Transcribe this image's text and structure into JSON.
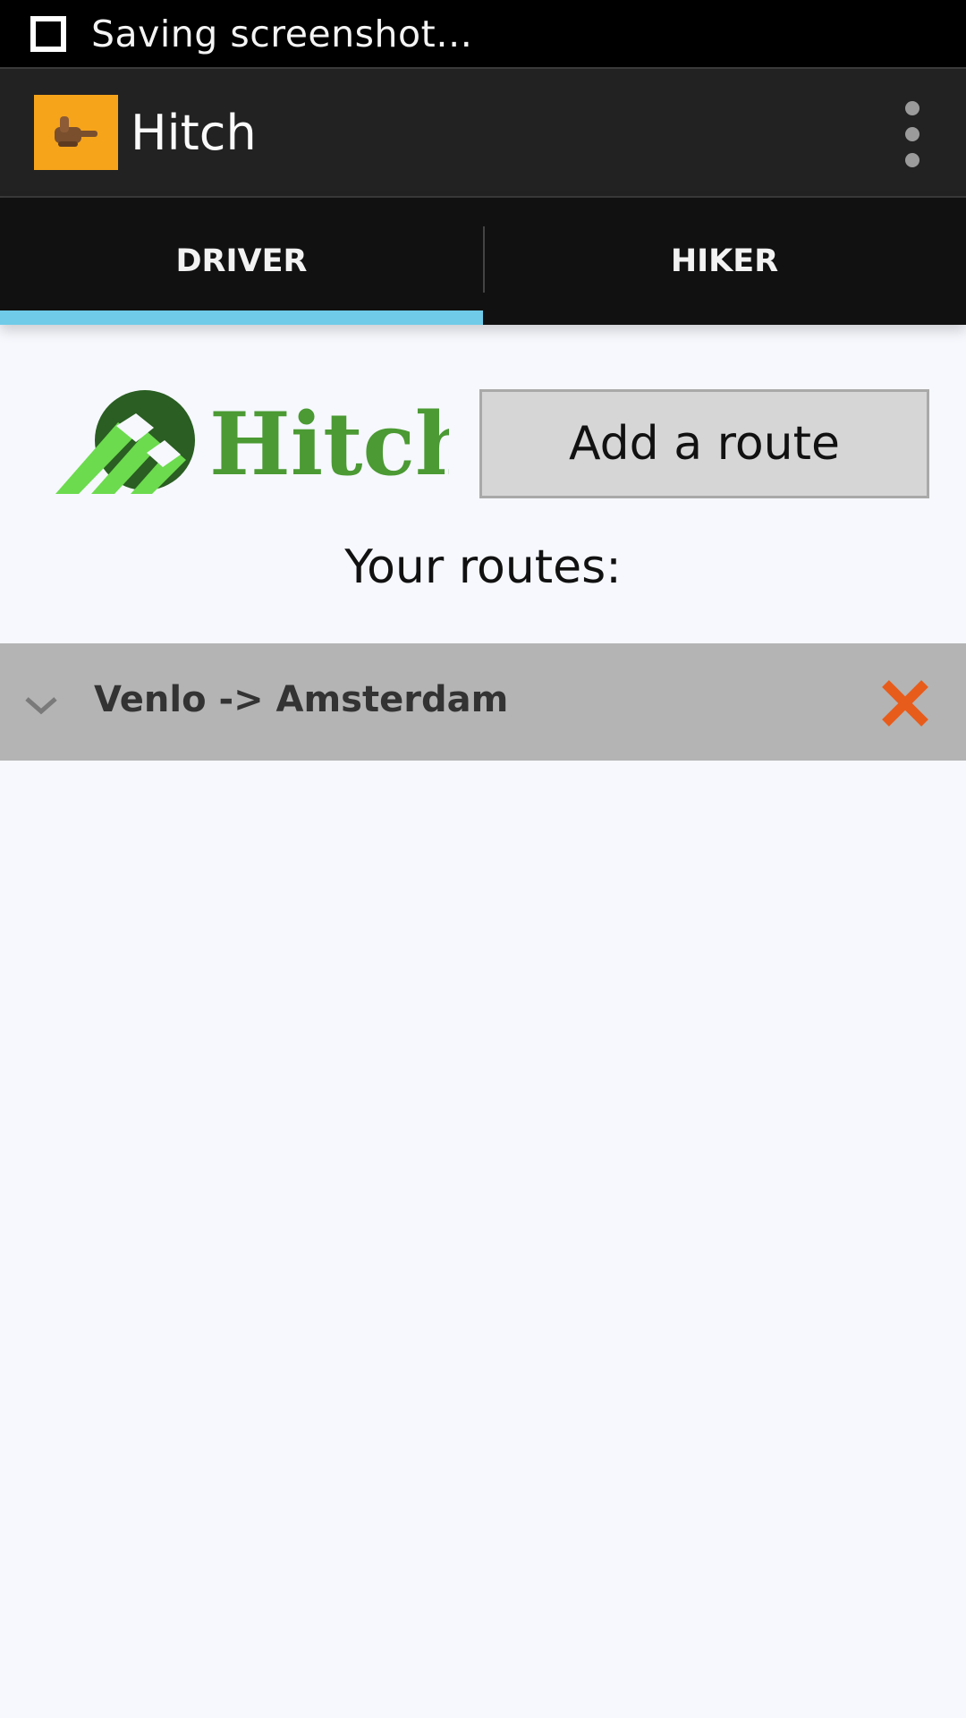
{
  "status_bar": {
    "text": "Saving screenshot…"
  },
  "action_bar": {
    "title": "Hitch",
    "app_icon": "thumbs-up-hitchhike-icon",
    "overflow_icon": "overflow-menu-icon"
  },
  "tabs": [
    {
      "label": "DRIVER",
      "selected": true
    },
    {
      "label": "HIKER",
      "selected": false
    }
  ],
  "logo": {
    "text": "Hitch",
    "colors": {
      "dark": "#2a5e22",
      "light": "#6cdb4e",
      "text": "#4b9a33"
    }
  },
  "add_route_button": {
    "label": "Add a route"
  },
  "routes_heading": "Your routes:",
  "routes": [
    {
      "label": "Venlo -> Amsterdam",
      "expand_icon": "chevron-down-icon",
      "delete_icon": "close-icon"
    }
  ],
  "colors": {
    "tab_indicator": "#6fcbe8",
    "app_icon_bg": "#f6a41a",
    "delete": "#e85c1b",
    "route_row_bg": "#b4b4b4",
    "background": "#f6f8fd"
  }
}
